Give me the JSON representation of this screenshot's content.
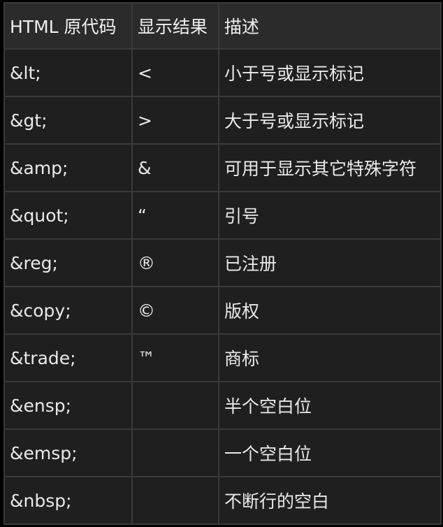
{
  "table": {
    "headers": [
      "HTML 原代码",
      "显示结果",
      "描述"
    ],
    "rows": [
      {
        "code": "&lt;",
        "result": "<",
        "desc": "小于号或显示标记"
      },
      {
        "code": "&gt;",
        "result": ">",
        "desc": "大于号或显示标记"
      },
      {
        "code": "&amp;",
        "result": "&",
        "desc": "可用于显示其它特殊字符"
      },
      {
        "code": "&quot;",
        "result": "“",
        "desc": "引号"
      },
      {
        "code": "&reg;",
        "result": "®",
        "desc": "已注册"
      },
      {
        "code": "&copy;",
        "result": "©",
        "desc": "版权"
      },
      {
        "code": "&trade;",
        "result": "™",
        "desc": "商标"
      },
      {
        "code": "&ensp;",
        "result": "",
        "desc": "半个空白位"
      },
      {
        "code": "&emsp;",
        "result": "",
        "desc": "一个空白位"
      },
      {
        "code": "&nbsp;",
        "result": "",
        "desc": "不断行的空白"
      }
    ]
  },
  "colors": {
    "page_background": "#000000",
    "cell_background": "#1f1f1f",
    "header_background": "#2b2b2b",
    "border": "#3a3a3a",
    "text": "#eaeaea"
  }
}
